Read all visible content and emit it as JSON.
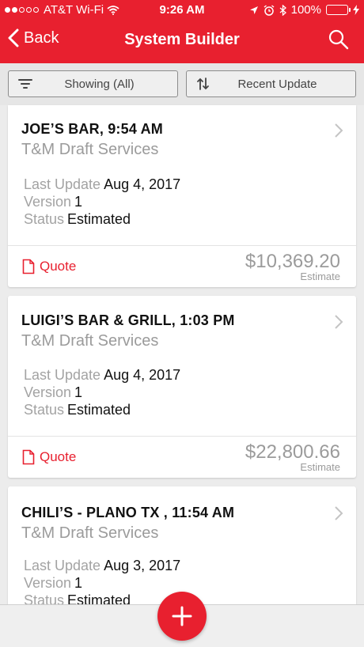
{
  "status_bar": {
    "carrier": "AT&T Wi-Fi",
    "time": "9:26 AM",
    "battery": "100%",
    "signal_dots": 2,
    "battery_level": 1.0
  },
  "nav": {
    "back_label": "Back",
    "title": "System Builder"
  },
  "toolbar": {
    "filter_label": "Showing (All)",
    "sort_label": "Recent Update"
  },
  "labels": {
    "last_update": "Last Update",
    "version": "Version",
    "status": "Status",
    "quote": "Quote",
    "estimate": "Estimate"
  },
  "cards": [
    {
      "title": "JOE’S BAR, 9:54 AM",
      "company": "T&M Draft Services",
      "last_update": "Aug 4, 2017",
      "version": "1",
      "status": "Estimated",
      "amount": "$10,369.20"
    },
    {
      "title": "LUIGI’S BAR & GRILL, 1:03 PM",
      "company": "T&M Draft Services",
      "last_update": "Aug 4, 2017",
      "version": "1",
      "status": "Estimated",
      "amount": "$22,800.66"
    },
    {
      "title": "CHILI’S - PLANO TX , 11:54 AM",
      "company": "T&M Draft Services",
      "last_update": "Aug 3, 2017",
      "version": "1",
      "status": "Estimated",
      "amount": ""
    }
  ],
  "colors": {
    "brand": "#e8202f",
    "muted_text": "#9b9b9b",
    "battery_fill": "#4cd964"
  },
  "icons": {
    "back": "chevron-left-icon",
    "search": "search-icon",
    "filter": "filter-lines-icon",
    "sort": "sort-arrows-icon",
    "card_chevron": "chevron-right-icon",
    "quote": "document-icon",
    "fab": "plus-icon"
  }
}
